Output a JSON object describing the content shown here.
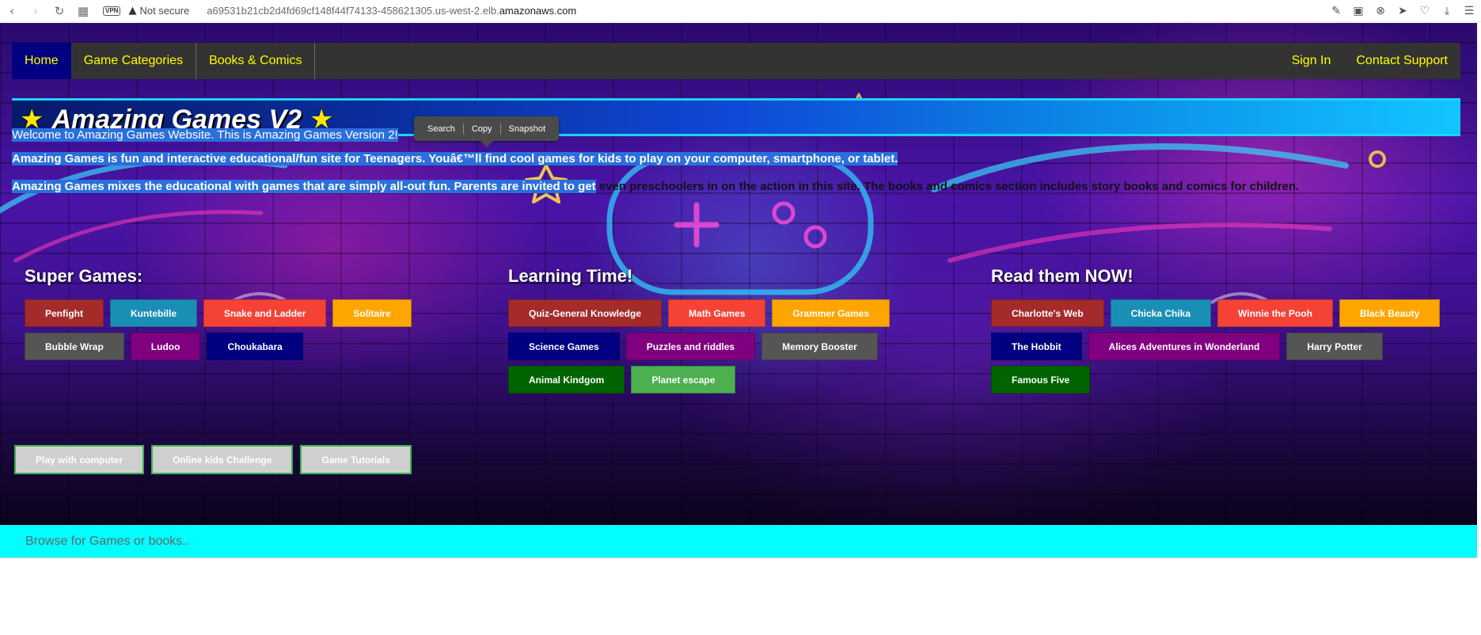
{
  "browser": {
    "vpn_label": "VPN",
    "security_text": "Not secure",
    "url_prefix": "a69531b21cb2d4fd69cf148f44f74133-458621305.us-west-2.elb.",
    "url_domain": "amazonaws.com",
    "icons": [
      "back-icon",
      "forward-icon",
      "reload-icon",
      "tabs-grid-icon",
      "warning-icon",
      "edit-icon",
      "camera-icon",
      "block-icon",
      "send-icon",
      "heart-icon",
      "download-icon",
      "menu-icon"
    ]
  },
  "nav": {
    "home": "Home",
    "game_categories": "Game Categories",
    "books_comics": "Books & Comics",
    "sign_in": "Sign In",
    "contact_support": "Contact Support"
  },
  "banner": {
    "title": "Amazing Games V2",
    "star_glyph": "★"
  },
  "selection_popup": {
    "search": "Search",
    "copy": "Copy",
    "snapshot": "Snapshot"
  },
  "intro": {
    "p1": "Welcome to Amazing Games Website. This is Amazing Games Version 2!",
    "p2": "Amazing Games is fun and interactive educational/fun site for Teenagers. Youâ€™ll find cool games for kids to play on your computer, smartphone, or tablet.",
    "p3_selected": "Amazing Games mixes the educational with games that are simply all-out fun. Parents are invited to get",
    "p3_rest": " even preschoolers in on the action in this site. The books and comics section includes story books and comics for children."
  },
  "sections": {
    "super_games": {
      "heading": "Super Games:",
      "items": [
        {
          "label": "Penfight",
          "color": "#a52a2a"
        },
        {
          "label": "Kuntebille",
          "color": "#1a8fb5"
        },
        {
          "label": "Snake and Ladder",
          "color": "#f44336"
        },
        {
          "label": "Solitaire",
          "color": "#ffa500"
        },
        {
          "label": "Bubble Wrap",
          "color": "#555555"
        },
        {
          "label": "Ludoo",
          "color": "#800080"
        },
        {
          "label": "Choukabara",
          "color": "#000080"
        }
      ]
    },
    "learning_time": {
      "heading": "Learning Time!",
      "items": [
        {
          "label": "Quiz-General Knowledge",
          "color": "#a52a2a"
        },
        {
          "label": "Math Games",
          "color": "#f44336"
        },
        {
          "label": "Grammer Games",
          "color": "#ffa500"
        },
        {
          "label": "Science Games",
          "color": "#000080"
        },
        {
          "label": "Puzzles and riddles",
          "color": "#800080"
        },
        {
          "label": "Memory Booster",
          "color": "#555555"
        },
        {
          "label": "Animal Kindgom",
          "color": "#006400"
        },
        {
          "label": "Planet escape",
          "color": "#4caf50"
        }
      ]
    },
    "read_them_now": {
      "heading": "Read them NOW!",
      "items": [
        {
          "label": "Charlotte's Web",
          "color": "#a52a2a"
        },
        {
          "label": "Chicka Chika",
          "color": "#1a8fb5"
        },
        {
          "label": "Winnie the Pooh",
          "color": "#f44336"
        },
        {
          "label": "Black Beauty",
          "color": "#ffa500"
        },
        {
          "label": "The Hobbit",
          "color": "#000080"
        },
        {
          "label": "Alices Adventures in Wonderland",
          "color": "#800080"
        },
        {
          "label": "Harry Potter",
          "color": "#555555"
        },
        {
          "label": "Famous Five",
          "color": "#006400"
        }
      ]
    }
  },
  "bottom_buttons": [
    "Play with computer",
    "Online kids Challenge",
    "Game Tutorials"
  ],
  "search": {
    "placeholder": "Browse for Games or books.."
  },
  "colors": {
    "nav_bg": "#333333",
    "nav_active": "#000080",
    "nav_text": "#ffff00",
    "search_bar": "#00ffff",
    "selection": "#2a6fdc"
  }
}
